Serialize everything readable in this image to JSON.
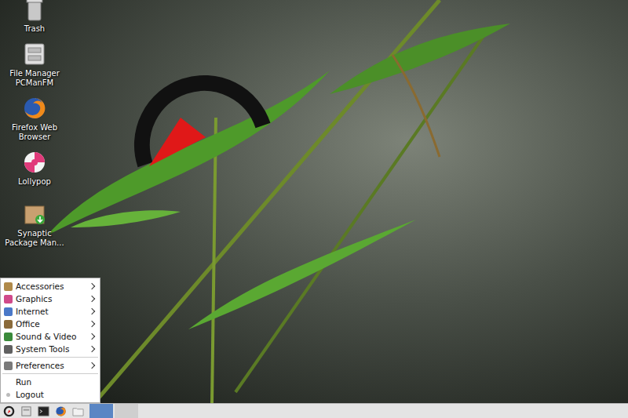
{
  "desktop": {
    "icons": [
      {
        "label": "Trash",
        "kind": "trash"
      },
      {
        "label": "File Manager PCManFM",
        "kind": "filemanager"
      },
      {
        "label": "Firefox Web Browser",
        "kind": "firefox"
      },
      {
        "label": "Lollypop",
        "kind": "lollypop"
      },
      {
        "label": "Synaptic Package Man...",
        "kind": "synaptic"
      }
    ]
  },
  "menu": {
    "sections": [
      {
        "items": [
          {
            "label": "Accessories",
            "has_submenu": true,
            "kind": "accessories"
          },
          {
            "label": "Graphics",
            "has_submenu": true,
            "kind": "graphics"
          },
          {
            "label": "Internet",
            "has_submenu": true,
            "kind": "internet"
          },
          {
            "label": "Office",
            "has_submenu": true,
            "kind": "office"
          },
          {
            "label": "Sound & Video",
            "has_submenu": true,
            "kind": "sound"
          },
          {
            "label": "System Tools",
            "has_submenu": true,
            "kind": "system"
          }
        ]
      },
      {
        "items": [
          {
            "label": "Preferences",
            "has_submenu": true,
            "kind": "preferences"
          }
        ]
      },
      {
        "items": [
          {
            "label": "Run",
            "has_submenu": false,
            "kind": "none"
          },
          {
            "label": "Logout",
            "has_submenu": false,
            "kind": "logout"
          }
        ]
      }
    ]
  },
  "taskbar": {
    "launchers": [
      {
        "kind": "menu"
      },
      {
        "kind": "filemanager"
      },
      {
        "kind": "terminal"
      },
      {
        "kind": "firefox"
      },
      {
        "kind": "folder"
      }
    ],
    "windows": [
      {
        "selected": true
      },
      {
        "selected": false
      }
    ]
  }
}
